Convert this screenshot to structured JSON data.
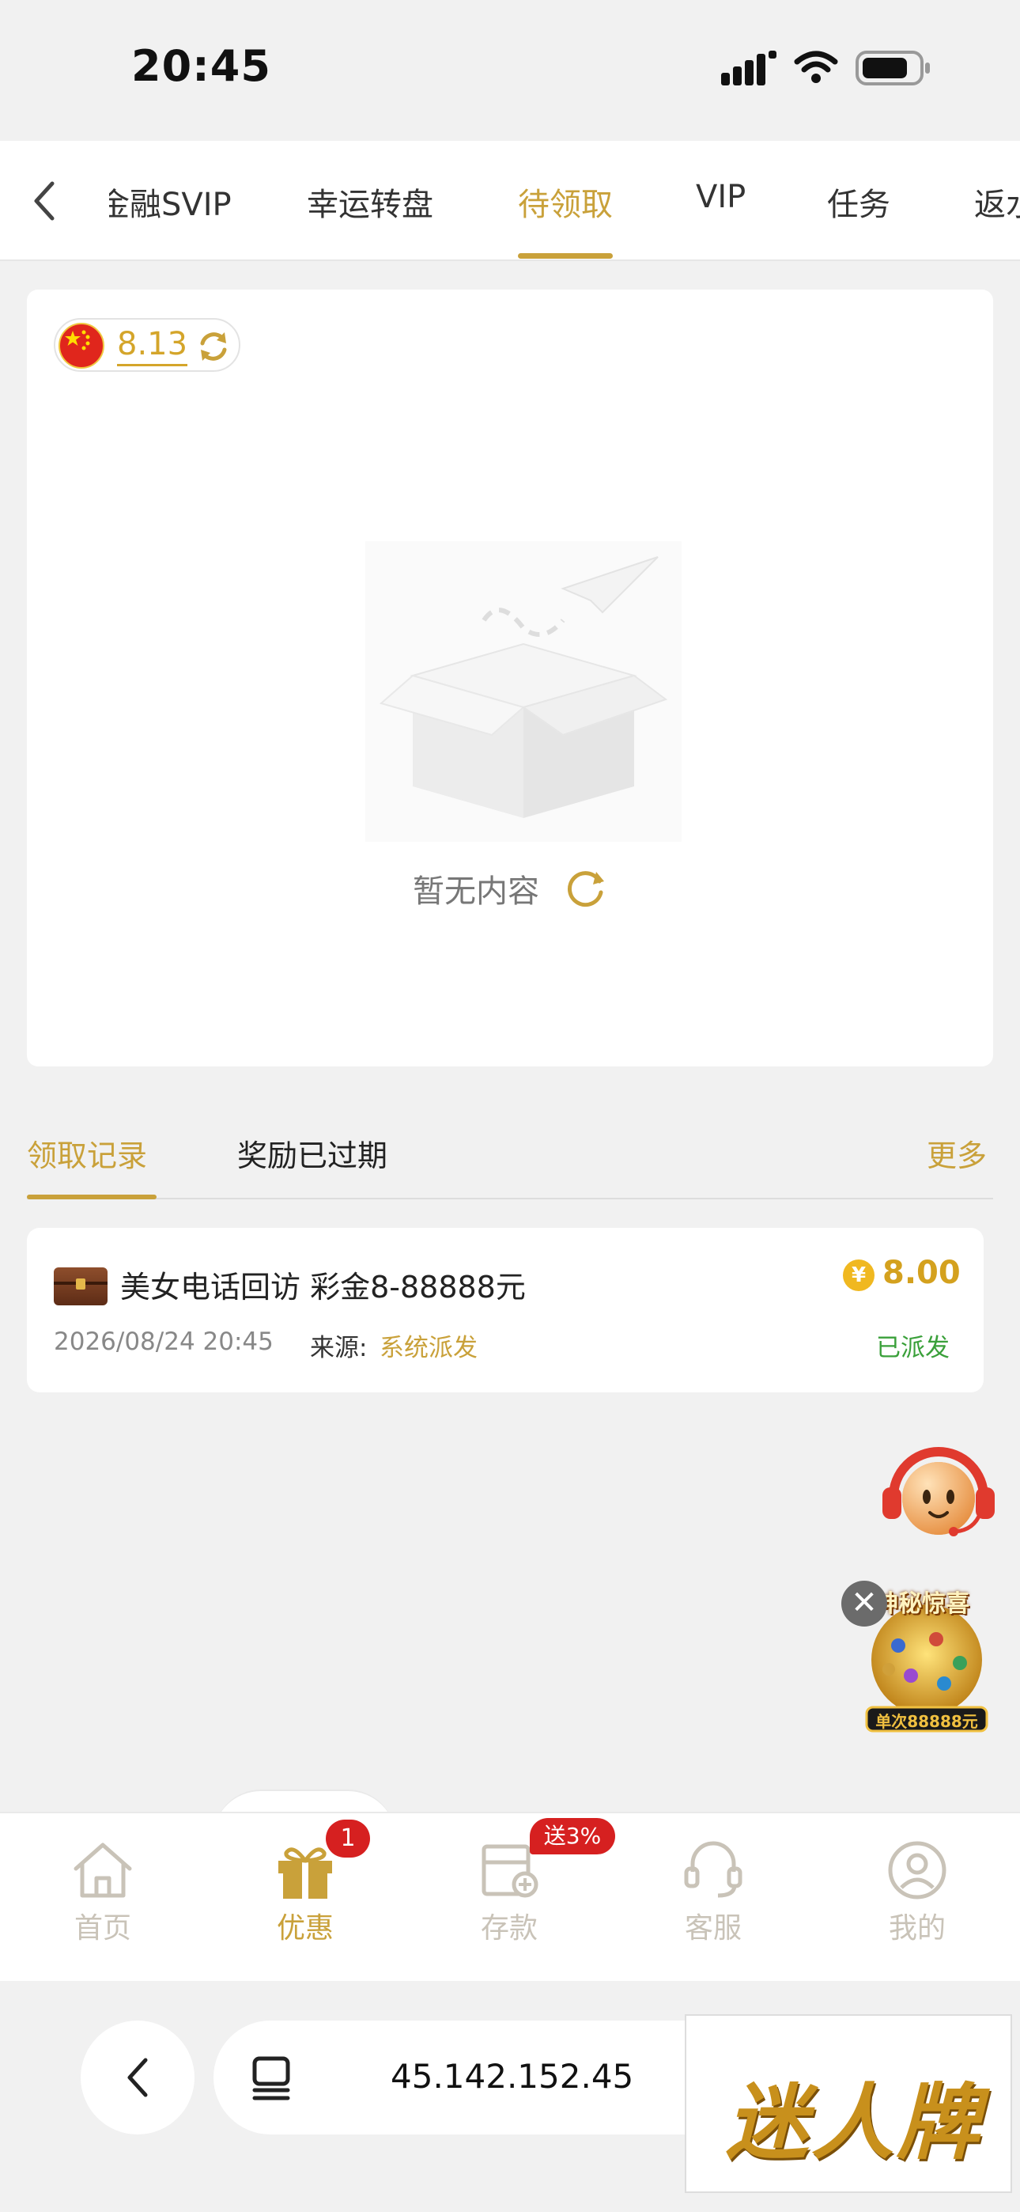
{
  "status_bar": {
    "time": "20:45"
  },
  "top_tabs": {
    "items": [
      "金融SVIP",
      "幸运转盘",
      "待领取",
      "VIP",
      "任务",
      "返水"
    ],
    "active": "待领取"
  },
  "balance": {
    "value": "8.13"
  },
  "empty_state": {
    "text": "暂无内容"
  },
  "records": {
    "tabs": [
      "领取记录",
      "奖励已过期"
    ],
    "more_label": "更多",
    "items": [
      {
        "title": "美女电话回访 彩金8-88888元",
        "amount": "8.00",
        "time": "2026/08/24 20:45",
        "source_label": "来源:",
        "source": "系统派发",
        "status": "已派发"
      }
    ]
  },
  "floating": {
    "promo_title": "神秘惊喜",
    "promo_subtitle": "单次88888元"
  },
  "bottom_nav": {
    "items": [
      "首页",
      "优惠",
      "存款",
      "客服",
      "我的"
    ],
    "active": "优惠",
    "promo_badge": "1",
    "deposit_badge": "送3%"
  },
  "browser": {
    "url": "45.142.152.45",
    "logo_text": "迷人牌"
  },
  "colors": {
    "accent": "#c9a13a",
    "badge": "#d62020",
    "success": "#3aa03a"
  }
}
